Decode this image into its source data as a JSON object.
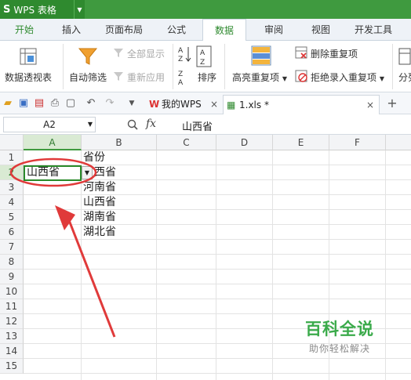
{
  "app": {
    "title": "WPS 表格",
    "logo_glyph": "S"
  },
  "tabs": [
    "开始",
    "插入",
    "页面布局",
    "公式",
    "数据",
    "审阅",
    "视图",
    "开发工具"
  ],
  "ribbon": {
    "pivot_table": "数据透视表",
    "auto_filter": "自动筛选",
    "show_all": "全部显示",
    "reapply": "重新应用",
    "sort": "排序",
    "highlight_duplicates": "高亮重复项",
    "delete_duplicates": "删除重复项",
    "reject_duplicates": "拒绝录入重复项",
    "split": "分列"
  },
  "doc_tabs": {
    "home": "我的WPS",
    "file": "1.xls *"
  },
  "formula_bar": {
    "name_box": "A2",
    "fx": "fx",
    "value": "山西省"
  },
  "columns": [
    "A",
    "B",
    "C",
    "D",
    "E",
    "F"
  ],
  "rows": [
    "1",
    "2",
    "3",
    "4",
    "5",
    "6",
    "7",
    "8",
    "9",
    "10",
    "11",
    "12",
    "13",
    "14",
    "15"
  ],
  "cells": {
    "B1": "省份",
    "A2": "山西省",
    "B2": "西省",
    "B3": "河南省",
    "B4": "山西省",
    "B5": "湖南省",
    "B6": "湖北省"
  },
  "watermark": {
    "title": "百科全说",
    "subtitle": "助你轻松解决"
  },
  "colors": {
    "brand_green": "#3f9a3f",
    "annotation_red": "#e03a3a"
  }
}
